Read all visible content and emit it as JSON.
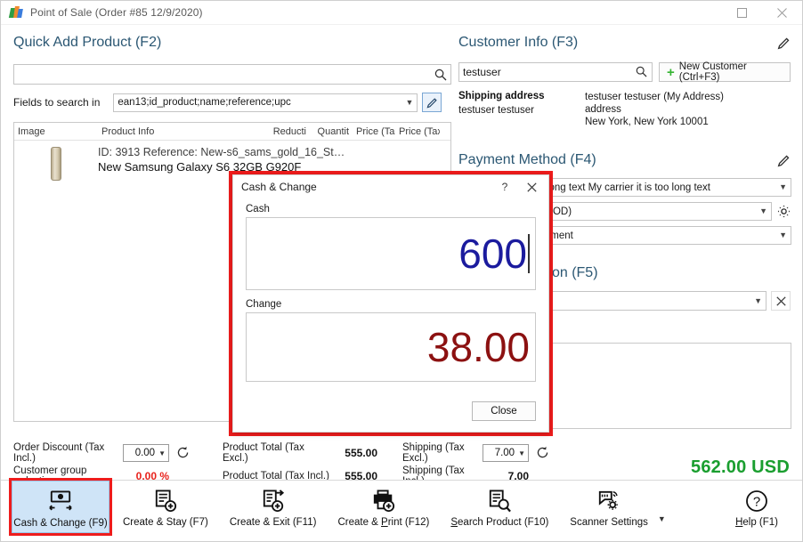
{
  "window": {
    "title": "Point of Sale (Order #85 12/9/2020)",
    "maximize_label": "Maximize",
    "close_label": "Close"
  },
  "quick_add": {
    "heading": "Quick Add Product (F2)",
    "search_value": "",
    "search_placeholder": "",
    "fields_label": "Fields to search in",
    "fields_value": "ean13;id_product;name;reference;upc",
    "edit_label": "Edit"
  },
  "grid": {
    "columns": [
      "Image",
      "Product Info",
      "Reducti",
      "Quantit",
      "Price (Ta›",
      "Price (Tax I"
    ],
    "rows": [
      {
        "info_line1": "ID: 3913 Reference: New-s6_sams_gold_16_St…",
        "info_line2": "New Samsung Galaxy S6 32GB G920F",
        "reduction": "",
        "quantity": "",
        "price_excl": "",
        "price_incl": ""
      }
    ]
  },
  "customer": {
    "heading": "Customer Info (F3)",
    "search_value": "testuser",
    "new_customer_label": "New Customer (Ctrl+F3)",
    "shipping_label": "Shipping address",
    "shipping_name": "testuser testuser",
    "address_lines": [
      "testuser testuser (My Address)",
      "address",
      "New York, New York 10001"
    ]
  },
  "payment": {
    "heading": "Payment Method (F4)",
    "carrier": "My carrier it is too long text My carrier it is too long text",
    "method": "Cash on delivery (COD)",
    "state": "Awaiting check payment"
  },
  "coupon": {
    "heading": "Discount Coupon (F5)",
    "value": "",
    "clear_label": "×",
    "note_value": ""
  },
  "summary": {
    "order_discount_label": "Order Discount (Tax Incl.)",
    "order_discount_value": "0.00",
    "customer_group_label": "Customer group reduction",
    "customer_group_value": "0.00 %",
    "product_total_excl_label": "Product Total (Tax Excl.)",
    "product_total_excl_value": "555.00",
    "product_total_incl_label": "Product Total (Tax Incl.)",
    "product_total_incl_value": "555.00",
    "shipping_excl_label": "Shipping (Tax Excl.)",
    "shipping_excl_value": "7.00",
    "shipping_incl_label": "Shipping (Tax Incl.)",
    "shipping_incl_value": "7.00",
    "grand_total": "562.00 USD"
  },
  "toolbar": {
    "cash_change": "Cash & Change (F9)",
    "create_stay": "Create & Stay (F7)",
    "create_exit": "Create & Exit (F11)",
    "create_print_pre": "Create & ",
    "create_print_key": "P",
    "create_print_post": "rint (F12)",
    "search_product_key": "S",
    "search_product_post": "earch Product (F10)",
    "scanner_settings": "Scanner Settings",
    "help_key": "H",
    "help_post": "elp (F1)"
  },
  "modal": {
    "title": "Cash & Change",
    "help_label": "?",
    "close_x_label": "×",
    "cash_label": "Cash",
    "cash_value": "600",
    "change_label": "Change",
    "change_value": "38.00",
    "close_label": "Close"
  },
  "colors": {
    "accent_blue": "#2b5773",
    "total_green": "#1a9e2f",
    "alert_red": "#e8221c",
    "highlight_red": "#ee1c1c",
    "cash_blue": "#1b1b9e",
    "change_dark_red": "#8c1111"
  }
}
